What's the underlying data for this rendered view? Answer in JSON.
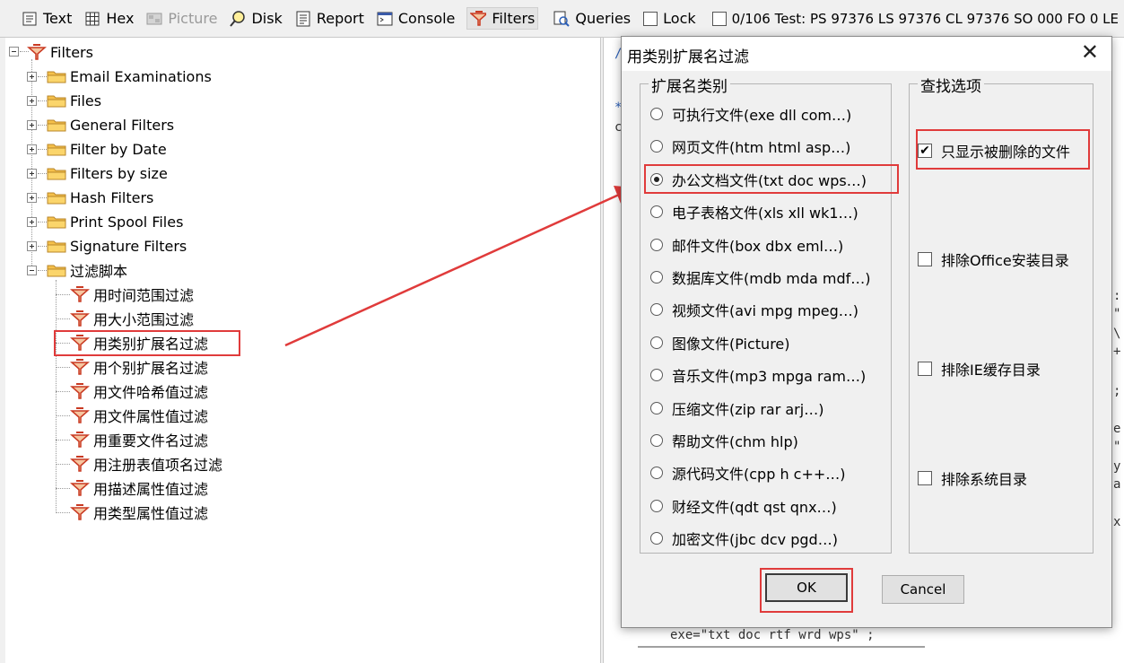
{
  "toolbar": {
    "items": [
      {
        "label": "Text",
        "icon": "text-view-icon"
      },
      {
        "label": "Hex",
        "icon": "hex-grid-icon"
      },
      {
        "label": "Picture",
        "icon": "picture-icon",
        "disabled": true
      },
      {
        "label": "Disk",
        "icon": "disk-magnifier-icon"
      },
      {
        "label": "Report",
        "icon": "report-icon"
      },
      {
        "label": "Console",
        "icon": "console-icon"
      },
      {
        "label": "Filters",
        "icon": "filter-funnel-icon",
        "active": true
      },
      {
        "label": "Queries",
        "icon": "queries-icon"
      }
    ],
    "lock_label": "Lock",
    "lock_checked": false,
    "status": {
      "count": "0/106",
      "test": "Test: PS 97376",
      "ls": "LS 97376",
      "cl": "CL 97376",
      "so": "SO 000",
      "fo": "FO 0",
      "le": "LE"
    }
  },
  "tree": {
    "root": "Filters",
    "folders": [
      "Email Examinations",
      "Files",
      "General Filters",
      "Filter by Date",
      "Filters by size",
      "Hash Filters",
      "Print Spool Files",
      "Signature Filters",
      "过滤脚本"
    ],
    "scripts": [
      "用时间范围过滤",
      "用大小范围过滤",
      "用类别扩展名过滤",
      "用个别扩展名过滤",
      "用文件哈希值过滤",
      "用文件属性值过滤",
      "用重要文件名过滤",
      "用注册表值项名过滤",
      "用描述属性值过滤",
      "用类型属性值过滤"
    ],
    "selected": "用类别扩展名过滤"
  },
  "code_snippets": {
    "bottom_line": "exe=\"txt doc rtf wrd wps\" ;",
    "c1": "/",
    "c2": "*",
    "c3": "c"
  },
  "dialog": {
    "title": "用类别扩展名过滤",
    "close_symbol": "✕",
    "category_group": "扩展名类别",
    "categories": [
      {
        "label": "可执行文件(exe dll com…)",
        "checked": false
      },
      {
        "label": "网页文件(htm html asp…)",
        "checked": false
      },
      {
        "label": "办公文档文件(txt doc wps…)",
        "checked": true
      },
      {
        "label": "电子表格文件(xls xll wk1…)",
        "checked": false
      },
      {
        "label": "邮件文件(box dbx eml…)",
        "checked": false
      },
      {
        "label": "数据库文件(mdb mda mdf…)",
        "checked": false
      },
      {
        "label": "视频文件(avi mpg mpeg…)",
        "checked": false
      },
      {
        "label": "图像文件(Picture)",
        "checked": false
      },
      {
        "label": "音乐文件(mp3 mpga ram…)",
        "checked": false
      },
      {
        "label": "压缩文件(zip rar arj…)",
        "checked": false
      },
      {
        "label": "帮助文件(chm hlp)",
        "checked": false
      },
      {
        "label": "源代码文件(cpp h c++…)",
        "checked": false
      },
      {
        "label": "财经文件(qdt qst qnx…)",
        "checked": false
      },
      {
        "label": "加密文件(jbc dcv pgd…)",
        "checked": false
      }
    ],
    "search_group": "查找选项",
    "options": [
      {
        "label": "只显示被删除的文件",
        "checked": true
      },
      {
        "label": "排除Office安装目录",
        "checked": false
      },
      {
        "label": "排除IE缓存目录",
        "checked": false
      },
      {
        "label": "排除系统目录",
        "checked": false
      }
    ],
    "ok_label": "OK",
    "cancel_label": "Cancel"
  },
  "colors": {
    "highlight": "#e03b3b",
    "folder": "#f5c04a",
    "filter_funnel": "#d9472b"
  }
}
